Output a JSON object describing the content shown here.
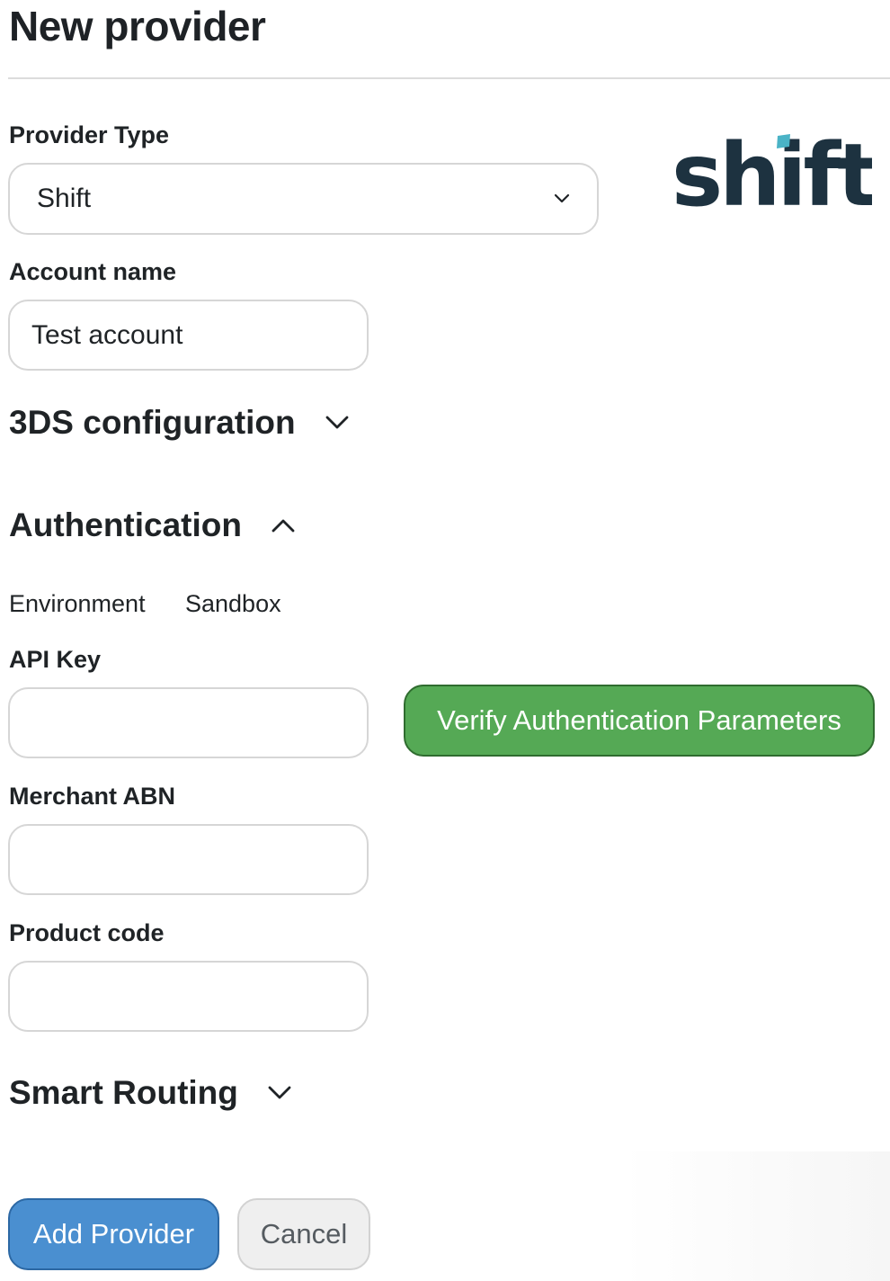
{
  "page": {
    "title": "New provider"
  },
  "provider_type": {
    "label": "Provider Type",
    "selected": "Shift",
    "chevron_icon": "chevron-down-icon"
  },
  "logo": {
    "text": "shift",
    "brand_color": "#1d3240",
    "accent_color": "#4ab3c6"
  },
  "account_name": {
    "label": "Account name",
    "value": "Test account"
  },
  "sections": {
    "three_ds": {
      "title": "3DS configuration",
      "expanded": false
    },
    "authentication": {
      "title": "Authentication",
      "expanded": true
    },
    "smart_routing": {
      "title": "Smart Routing",
      "expanded": false
    }
  },
  "authentication": {
    "environment_label": "Environment",
    "environment_value": "Sandbox",
    "api_key": {
      "label": "API Key",
      "value": ""
    },
    "merchant_abn": {
      "label": "Merchant ABN",
      "value": ""
    },
    "product_code": {
      "label": "Product code",
      "value": ""
    },
    "verify_label": "Verify Authentication Parameters",
    "verify_color": "#55a955"
  },
  "actions": {
    "add_label": "Add Provider",
    "add_color": "#4a8fd0",
    "cancel_label": "Cancel"
  }
}
